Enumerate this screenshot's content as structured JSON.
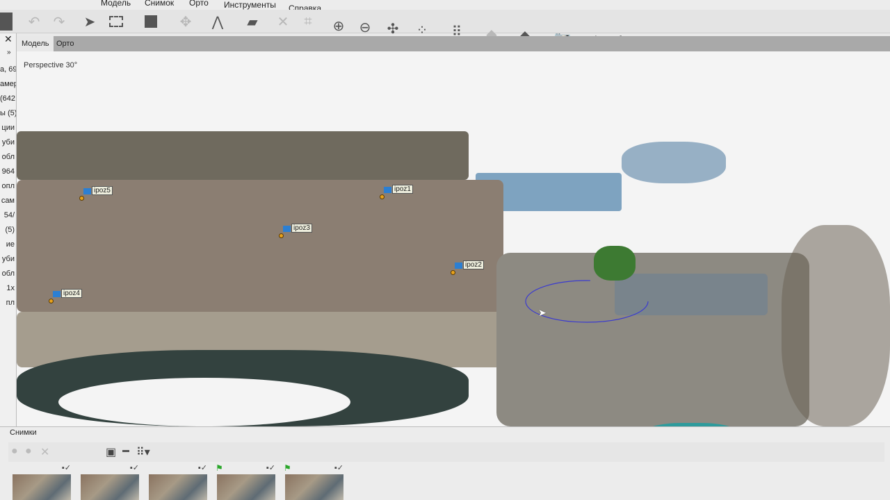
{
  "menu": [
    "Модель",
    "Снимок",
    "Орто",
    "Инструменты",
    "Справка"
  ],
  "workspace_rows": [
    "а, 69",
    "амер",
    "(642",
    "ы (5)",
    "ции",
    "уби",
    "обл",
    "964",
    "опл",
    "сам",
    "54/",
    "(5)",
    "ие",
    "уби",
    "обл",
    "1х",
    "пл"
  ],
  "tabs": [
    {
      "label": "Модель",
      "active": true
    },
    {
      "label": "Орто",
      "active": false
    }
  ],
  "viewport": {
    "projection": "Perspective 30°"
  },
  "markers": [
    "ipoz1",
    "ipoz2",
    "ipoz3",
    "ipoz4",
    "ipoz5"
  ],
  "photos_panel": {
    "title": "Снимки"
  },
  "colors": {
    "marker_flag": "#2c7fd2",
    "marker_point": "#e8a21c",
    "accent_selection": "#3a3ad0"
  }
}
